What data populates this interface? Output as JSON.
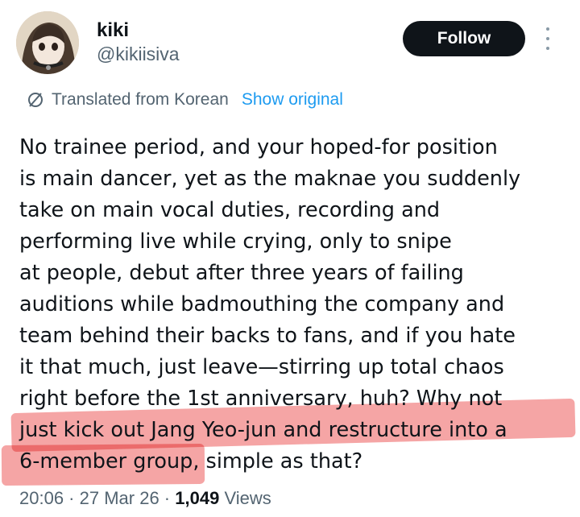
{
  "user": {
    "display_name": "kiki",
    "handle": "@kikiisiva",
    "avatar_icon": "profile-avatar"
  },
  "actions": {
    "follow_label": "Follow",
    "more_icon": "more-vertical-icon"
  },
  "translation": {
    "icon": "translate-globe-icon",
    "label": "Translated from Korean",
    "show_original_label": "Show original"
  },
  "tweet": {
    "lines": [
      "No trainee period, and your hoped-for position",
      "is main dancer, yet as the maknae you suddenly",
      "take on main vocal duties, recording and",
      "performing live while crying, only to snipe",
      "at people, debut after three years of failing",
      "auditions while badmouthing the company and",
      "team behind their backs to fans, and if you hate",
      "it that much, just leave—stirring up total chaos",
      "right before the 1st anniversary, huh? Why not",
      "just kick out Jang Yeo-jun and restructure into a",
      "6-member group, simple as that?"
    ],
    "highlight_color": "#f28b8b"
  },
  "meta": {
    "time": "20:06",
    "date": "27 Mar 26",
    "separator": " · ",
    "views_count": "1,049",
    "views_label": "Views"
  },
  "colors": {
    "text": "#0f1419",
    "secondary": "#536471",
    "link": "#1d9bf0",
    "button_bg": "#0f1419"
  }
}
